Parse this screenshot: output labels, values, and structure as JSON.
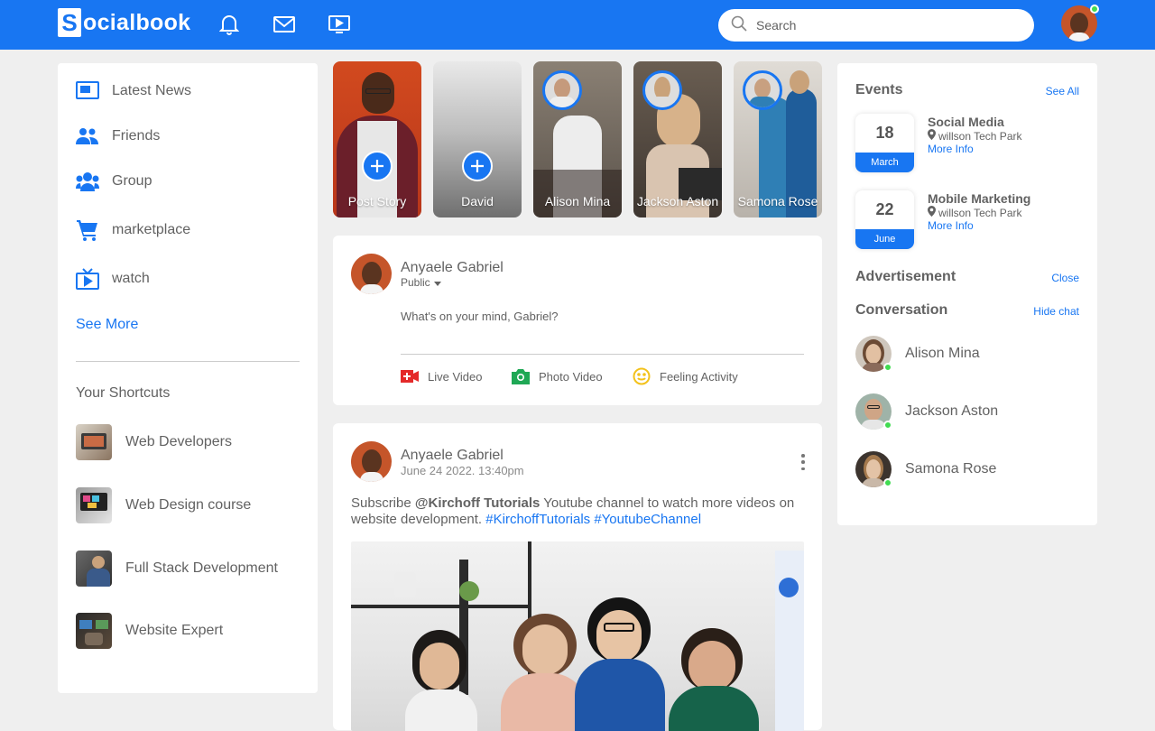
{
  "header": {
    "logo_letter": "S",
    "logo_text": "ocialbook",
    "search_placeholder": "Search",
    "colors": {
      "brand": "#1876f2",
      "online": "#41db51"
    }
  },
  "sidebar": {
    "items": [
      {
        "label": "Latest News",
        "icon": "news-icon"
      },
      {
        "label": "Friends",
        "icon": "friends-icon"
      },
      {
        "label": "Group",
        "icon": "group-icon"
      },
      {
        "label": "marketplace",
        "icon": "cart-icon"
      },
      {
        "label": "watch",
        "icon": "tv-icon"
      }
    ],
    "see_more": "See More",
    "shortcuts_title": "Your Shortcuts",
    "shortcuts": [
      {
        "label": "Web Developers"
      },
      {
        "label": "Web Design course"
      },
      {
        "label": "Full Stack Development"
      },
      {
        "label": "Website Expert"
      }
    ]
  },
  "stories": [
    {
      "name": "Post Story",
      "type": "add"
    },
    {
      "name": "David",
      "type": "add"
    },
    {
      "name": "Alison Mina",
      "type": "story"
    },
    {
      "name": "Jackson Aston",
      "type": "story"
    },
    {
      "name": "Samona Rose",
      "type": "story"
    }
  ],
  "composer": {
    "user_name": "Anyaele Gabriel",
    "privacy": "Public",
    "placeholder": "What's on your mind, Gabriel?",
    "actions": [
      {
        "label": "Live Video",
        "icon": "live-video-icon"
      },
      {
        "label": "Photo Video",
        "icon": "camera-icon"
      },
      {
        "label": "Feeling Activity",
        "icon": "smiley-icon"
      }
    ]
  },
  "post": {
    "user_name": "Anyaele Gabriel",
    "timestamp": "June 24 2022. 13:40pm",
    "text_before": "Subscribe ",
    "text_bold": "@Kirchoff Tutorials",
    "text_after": " Youtube channel to watch more videos on website development. ",
    "hashtag1": "#KirchoffTutorials",
    "hashtag2": "#YoutubeChannel"
  },
  "right": {
    "events_title": "Events",
    "see_all": "See All",
    "events": [
      {
        "day": "18",
        "month": "March",
        "title": "Social Media",
        "location": "willson Tech Park",
        "more": "More Info"
      },
      {
        "day": "22",
        "month": "June",
        "title": "Mobile Marketing",
        "location": "willson Tech Park",
        "more": "More Info"
      }
    ],
    "ad_title": "Advertisement",
    "ad_close": "Close",
    "conversation_title": "Conversation",
    "hide_chat": "Hide chat",
    "contacts": [
      {
        "name": "Alison Mina"
      },
      {
        "name": "Jackson Aston"
      },
      {
        "name": "Samona Rose"
      }
    ]
  }
}
